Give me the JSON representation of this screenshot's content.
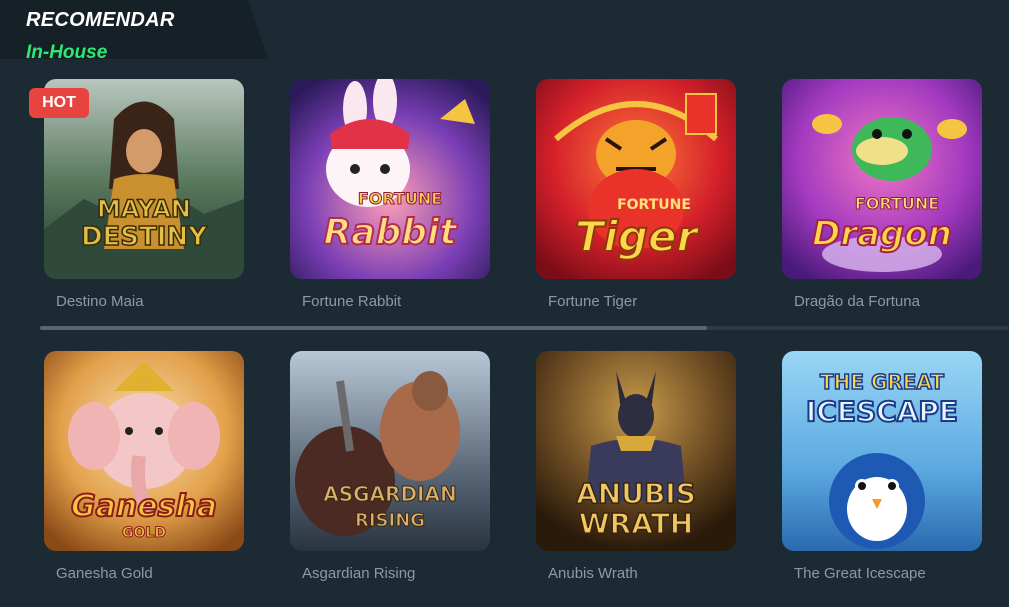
{
  "section": {
    "title": "RECOMENDAR",
    "subtitle": "In-House"
  },
  "badge": {
    "hot": "HOT"
  },
  "games": [
    {
      "name": "Destino Maia",
      "logo": [
        "MAYAN",
        "DESTINY"
      ]
    },
    {
      "name": "Fortune Rabbit",
      "logo": [
        "FORTUNE",
        "Rabbit"
      ]
    },
    {
      "name": "Fortune Tiger",
      "logo": [
        "FORTUNE",
        "Tiger"
      ]
    },
    {
      "name": "Dragão da Fortuna",
      "logo": [
        "FORTUNE",
        "Dragon"
      ]
    },
    {
      "name": "Ganesha Gold",
      "logo": [
        "Ganesha",
        "GOLD"
      ]
    },
    {
      "name": "Asgardian Rising",
      "logo": [
        "ASGARDIAN",
        "RISING"
      ]
    },
    {
      "name": "Anubis Wrath",
      "logo": [
        "ANUBIS",
        "WRATH"
      ]
    },
    {
      "name": "The Great Icescape",
      "logo": [
        "THE GREAT",
        "ICESCAPE"
      ]
    }
  ],
  "scrollbar": {
    "position": 0.69
  }
}
